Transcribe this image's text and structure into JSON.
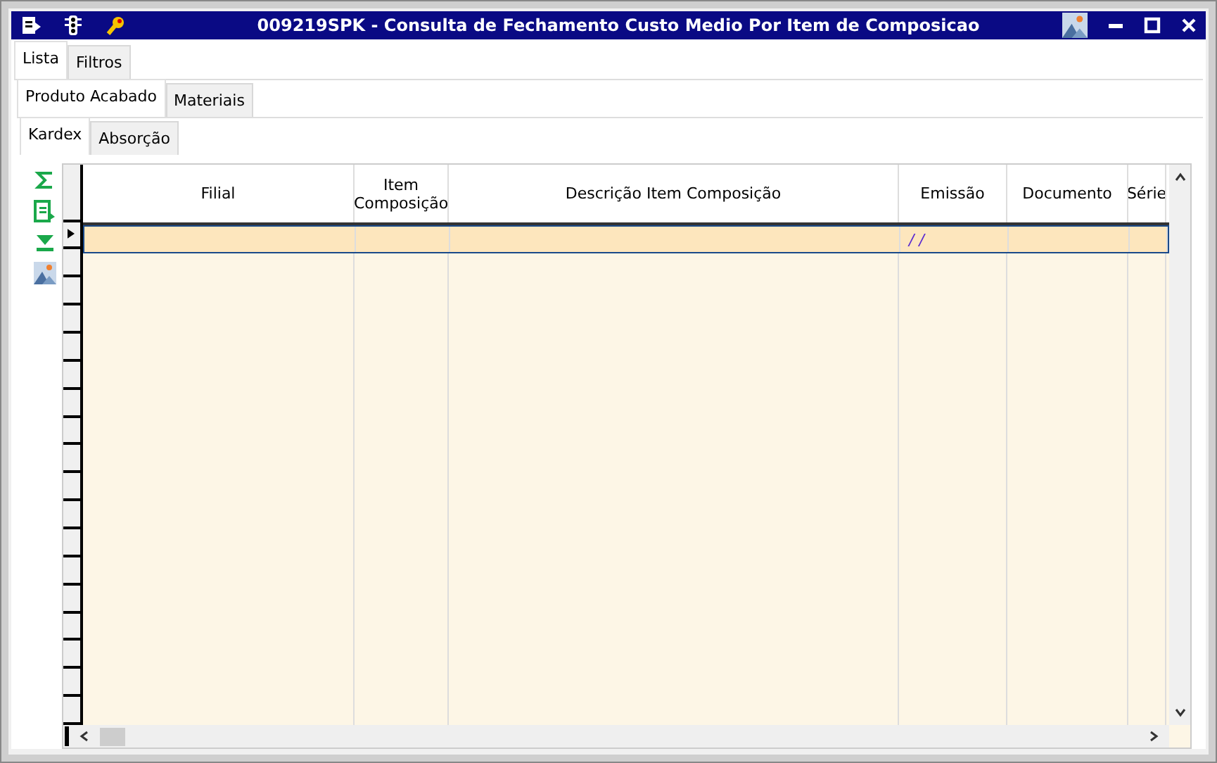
{
  "window": {
    "title": "009219SPK - Consulta de Fechamento Custo Medio Por Item de Composicao"
  },
  "tabs": [
    {
      "label": "Lista",
      "selected": true
    },
    {
      "label": "Filtros",
      "selected": false
    }
  ],
  "subtabs": [
    {
      "label": "Produto Acabado",
      "selected": true
    },
    {
      "label": "Materiais",
      "selected": false
    }
  ],
  "subsubtabs": [
    {
      "label": "Kardex",
      "selected": true
    },
    {
      "label": "Absorção",
      "selected": false
    }
  ],
  "table": {
    "columns": [
      {
        "label": "Filial"
      },
      {
        "label": "Item Composição"
      },
      {
        "label": "Descrição Item Composição"
      },
      {
        "label": "Emissão"
      },
      {
        "label": "Documento"
      },
      {
        "label": "Série"
      }
    ],
    "rows": [
      {
        "selected": true,
        "cells": [
          "",
          "",
          "",
          "/ /",
          "",
          ""
        ]
      }
    ]
  }
}
